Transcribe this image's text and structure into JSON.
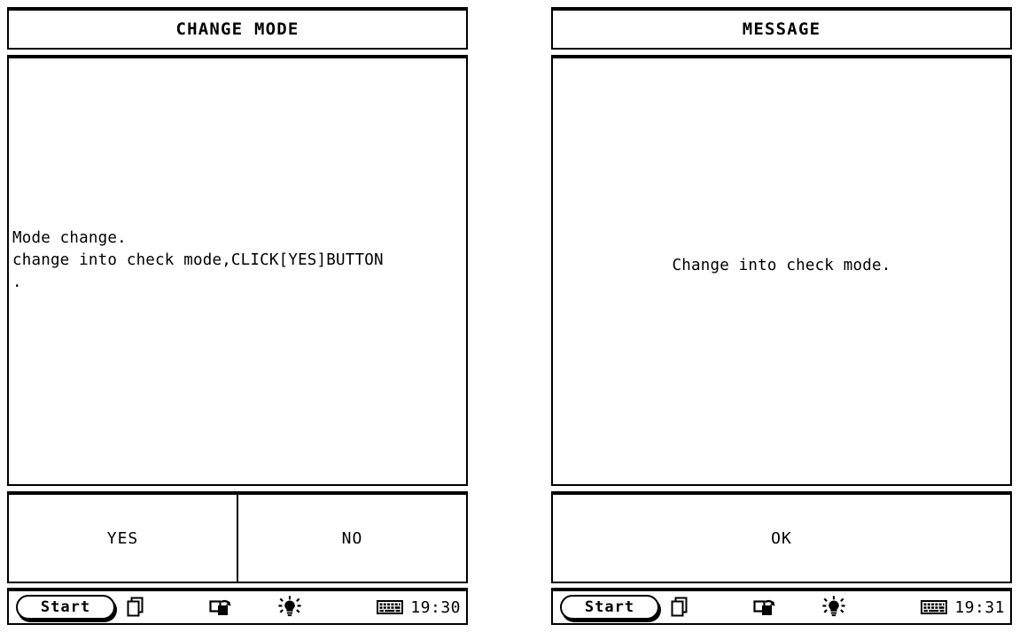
{
  "screens": [
    {
      "id": "change-mode",
      "titlebar": {
        "title": "CHANGE MODE"
      },
      "content": {
        "align": "left",
        "lines": [
          "Mode change.",
          "change into check mode,CLICK[YES]BUTTON",
          "."
        ]
      },
      "buttons": [
        {
          "label": "YES"
        },
        {
          "label": "NO"
        }
      ],
      "taskbar": {
        "start_label": "Start",
        "clock": "19:30",
        "icons": [
          "windows-stack-icon",
          "screen-rotate-icon",
          "brightness-icon",
          "keyboard-icon"
        ]
      }
    },
    {
      "id": "message",
      "titlebar": {
        "title": "MESSAGE"
      },
      "content": {
        "align": "center",
        "lines": [
          "Change into check mode."
        ]
      },
      "buttons": [
        {
          "label": "OK"
        }
      ],
      "taskbar": {
        "start_label": "Start",
        "clock": "19:31",
        "icons": [
          "windows-stack-icon",
          "screen-rotate-icon",
          "brightness-icon",
          "keyboard-icon"
        ]
      }
    }
  ],
  "colors": {
    "ink": "#000000",
    "paper": "#ffffff"
  }
}
